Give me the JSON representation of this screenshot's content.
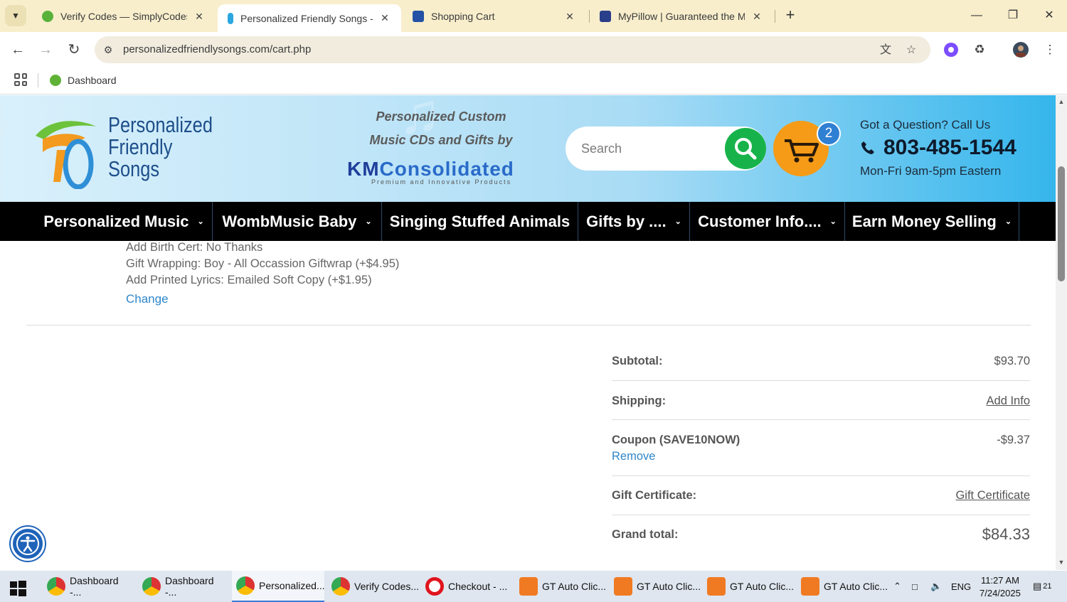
{
  "browser": {
    "tabs": [
      {
        "title": "Verify Codes — SimplyCodes",
        "active": false
      },
      {
        "title": "Personalized Friendly Songs - S",
        "active": true
      },
      {
        "title": "Shopping Cart",
        "active": false
      },
      {
        "title": "MyPillow | Guaranteed the Mos",
        "active": false
      }
    ],
    "url": "personalizedfriendlysongs.com/cart.php",
    "bookmarks": [
      {
        "label": "Dashboard"
      }
    ]
  },
  "site": {
    "logo_text": [
      "Personalized",
      "Friendly",
      "Songs"
    ],
    "tagline": [
      "Personalized Custom",
      "Music CDs and Gifts by"
    ],
    "brand": {
      "km": "KM",
      "consolidated": "Consolidated",
      "sub": "Premium and Innovative Products"
    },
    "search_placeholder": "Search",
    "cart_count": "2",
    "contact": {
      "question": "Got a Question? Call Us",
      "phone": "803-485-1544",
      "hours": "Mon-Fri 9am-5pm Eastern"
    },
    "nav": [
      {
        "label": "Personalized Music",
        "dropdown": true
      },
      {
        "label": "WombMusic Baby",
        "dropdown": true
      },
      {
        "label": "Singing Stuffed Animals",
        "dropdown": false
      },
      {
        "label": "Gifts by ....",
        "dropdown": true
      },
      {
        "label": "Customer Info....",
        "dropdown": true
      },
      {
        "label": "Earn Money Selling",
        "dropdown": true
      }
    ]
  },
  "cart": {
    "item_options": [
      "Add Birth Cert: No Thanks",
      "Gift Wrapping: Boy - All Occassion Giftwrap (+$4.95)",
      "Add Printed Lyrics: Emailed Soft Copy (+$1.95)"
    ],
    "change_label": "Change",
    "totals": {
      "subtotal_label": "Subtotal:",
      "subtotal_value": "$93.70",
      "shipping_label": "Shipping:",
      "shipping_value": "Add Info",
      "coupon_label": "Coupon (SAVE10NOW)",
      "coupon_value": "-$9.37",
      "remove_label": "Remove",
      "gift_label": "Gift Certificate:",
      "gift_value": "Gift Certificate",
      "grand_label": "Grand total:",
      "grand_value": "$84.33"
    }
  },
  "taskbar": {
    "apps": [
      {
        "label": "Dashboard -..."
      },
      {
        "label": "Dashboard -..."
      },
      {
        "label": "Personalized..."
      },
      {
        "label": "Verify Codes..."
      },
      {
        "label": "Checkout - ..."
      },
      {
        "label": "GT Auto Clic..."
      },
      {
        "label": "GT Auto Clic..."
      },
      {
        "label": "GT Auto Clic..."
      },
      {
        "label": "GT Auto Clic..."
      }
    ],
    "lang": "ENG",
    "time": "11:27 AM",
    "date": "7/24/2025",
    "notifications": "21"
  },
  "colors": {
    "accent_green": "#17b34a",
    "cart_orange": "#f59b17",
    "link_blue": "#2f86c9",
    "nav_bg": "#000000"
  }
}
